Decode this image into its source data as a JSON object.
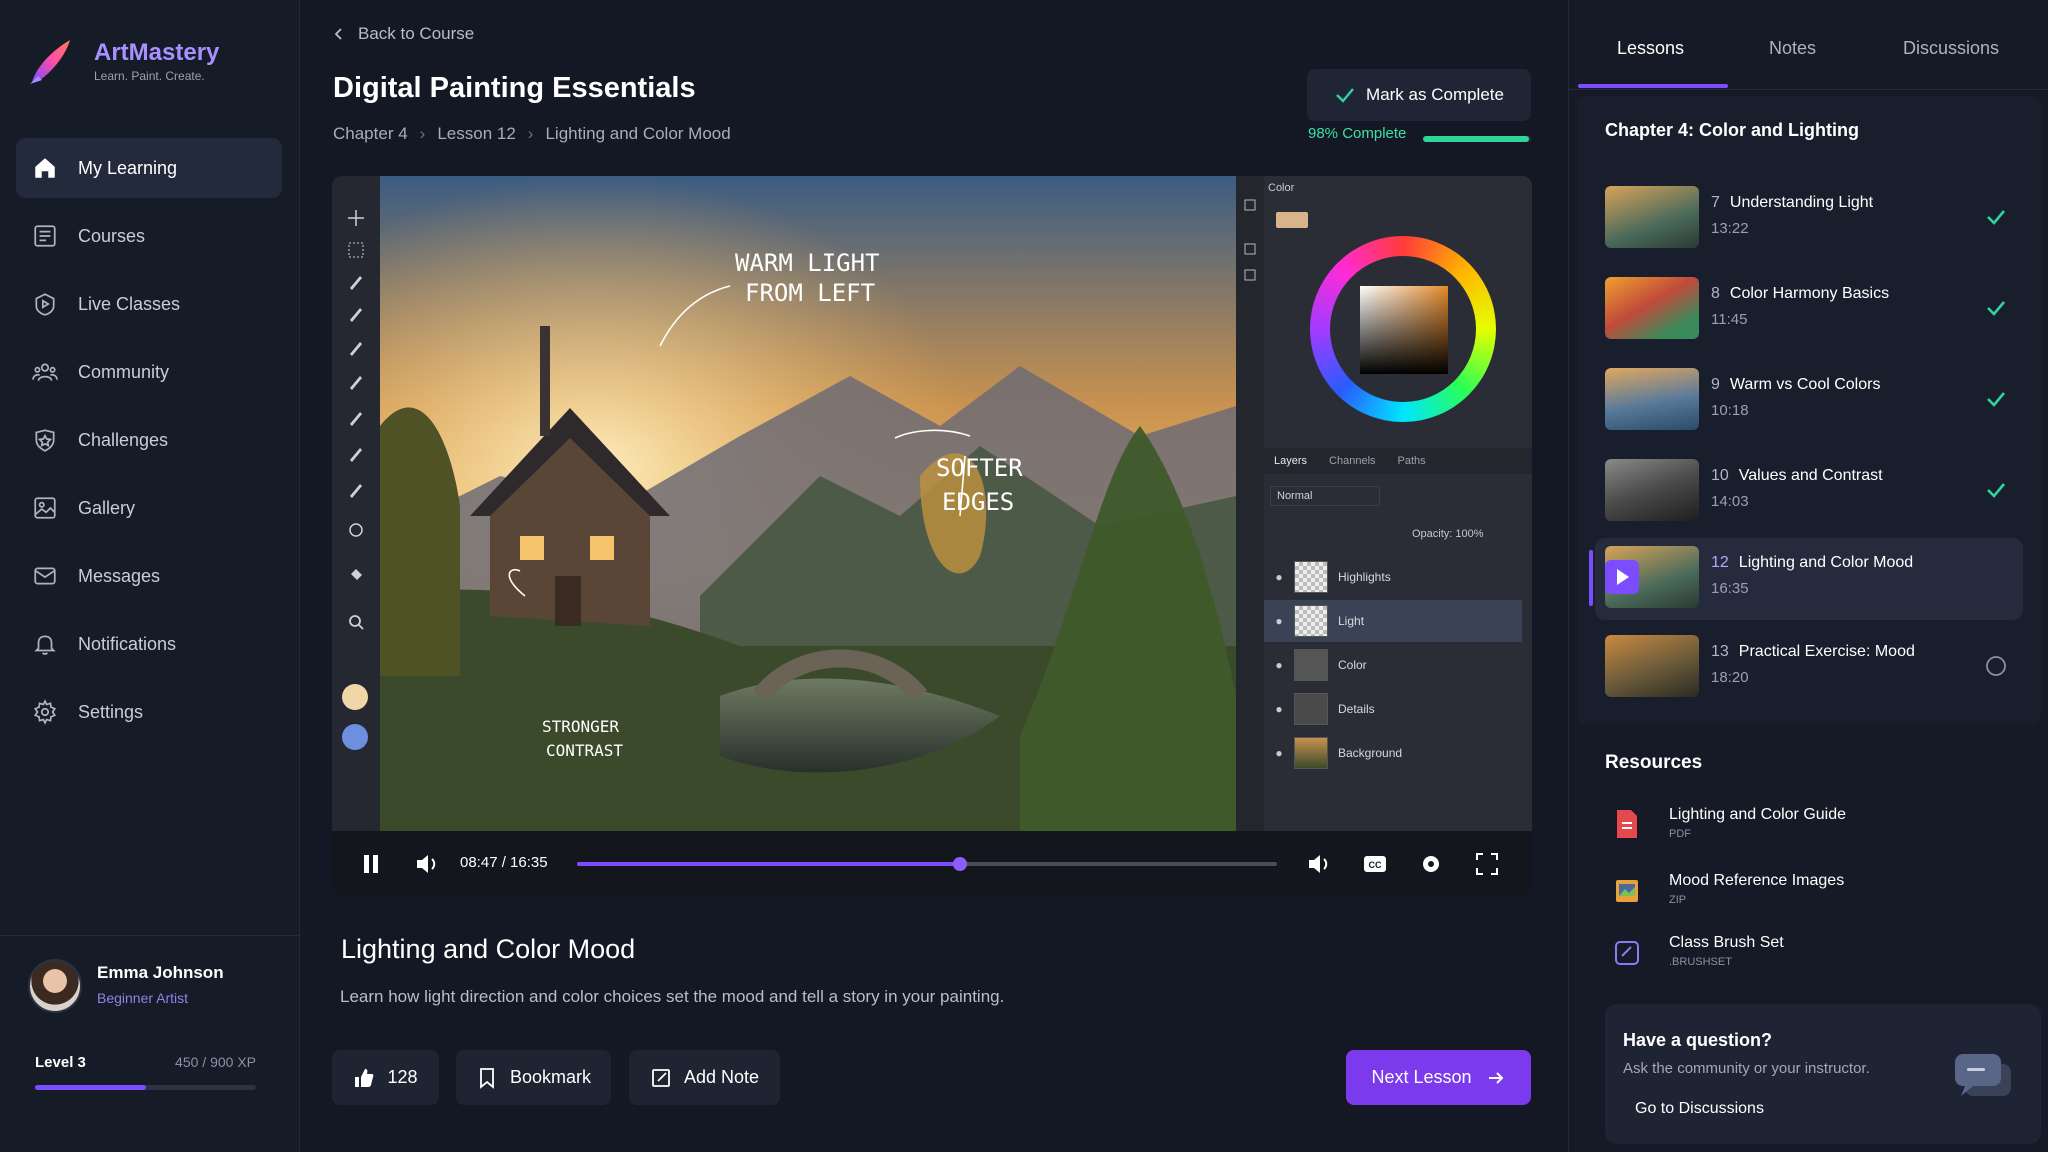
{
  "brand": {
    "name": "ArtMastery",
    "tagline": "Learn. Paint. Create."
  },
  "nav": [
    {
      "label": "My Learning",
      "icon": "home-icon",
      "active": true
    },
    {
      "label": "Courses",
      "icon": "courses-icon"
    },
    {
      "label": "Live Classes",
      "icon": "live-icon"
    },
    {
      "label": "Community",
      "icon": "community-icon"
    },
    {
      "label": "Challenges",
      "icon": "challenges-icon"
    },
    {
      "label": "Gallery",
      "icon": "gallery-icon"
    },
    {
      "label": "Messages",
      "icon": "messages-icon"
    },
    {
      "label": "Notifications",
      "icon": "bell-icon"
    },
    {
      "label": "Settings",
      "icon": "gear-icon"
    }
  ],
  "profile": {
    "name": "Emma Johnson",
    "role": "Beginner Artist",
    "level": "Level 3",
    "xp": "450 / 900 XP",
    "xp_fraction": 0.5
  },
  "header": {
    "back": "Back to Course",
    "title": "Digital Painting Essentials",
    "breadcrumb": [
      "Chapter 4",
      "Lesson 12",
      "Lighting and Color Mood"
    ],
    "mark_complete": "Mark as Complete",
    "progress_label": "98% Complete",
    "progress": 0.98
  },
  "video": {
    "annotations": [
      "WARM LIGHT",
      "FROM LEFT",
      "SOFTER",
      "EDGES",
      "STRONGER",
      "CONTRAST"
    ],
    "panel": {
      "color_label": "Color",
      "tabs": [
        "Layers",
        "Channels",
        "Paths"
      ],
      "blend": "Normal",
      "opacity": "Opacity:  100%",
      "layers": [
        "Highlights",
        "Light",
        "Color",
        "Details",
        "Background"
      ]
    },
    "time": "08:47 / 16:35",
    "seek_fraction": 0.547
  },
  "lesson": {
    "title": "Lighting and Color Mood",
    "description": "Learn how light direction and color choices set the mood and tell a story in your painting.",
    "likes": "128",
    "bookmark": "Bookmark",
    "add_note": "Add Note",
    "next": "Next Lesson"
  },
  "right": {
    "tabs": [
      "Lessons",
      "Notes",
      "Discussions"
    ],
    "chapter": "Chapter 4: Color and Lighting",
    "lessons": [
      {
        "num": "7",
        "title": "Understanding Light",
        "duration": "13:22",
        "status": "complete"
      },
      {
        "num": "8",
        "title": "Color Harmony Basics",
        "duration": "11:45",
        "status": "complete"
      },
      {
        "num": "9",
        "title": "Warm vs Cool Colors",
        "duration": "10:18",
        "status": "complete"
      },
      {
        "num": "10",
        "title": "Values and Contrast",
        "duration": "14:03",
        "status": "complete"
      },
      {
        "num": "12",
        "title": "Lighting and Color Mood",
        "duration": "16:35",
        "status": "current"
      },
      {
        "num": "13",
        "title": "Practical Exercise: Mood",
        "duration": "18:20",
        "status": "incomplete"
      }
    ],
    "resources_title": "Resources",
    "resources": [
      {
        "name": "Lighting and Color Guide",
        "type": "PDF",
        "color": "#e5484d"
      },
      {
        "name": "Mood Reference Images",
        "type": "ZIP",
        "color": "#e6a23c"
      },
      {
        "name": "Class Brush Set",
        "type": ".BRUSHSET",
        "color": "#8b7bf0"
      }
    ],
    "ask": {
      "title": "Have a question?",
      "subtitle": "Ask the community or your instructor.",
      "link": "Go to Discussions"
    }
  },
  "colors": {
    "accent": "#7c4dff",
    "success": "#2fd59a",
    "bg": "#141824"
  }
}
